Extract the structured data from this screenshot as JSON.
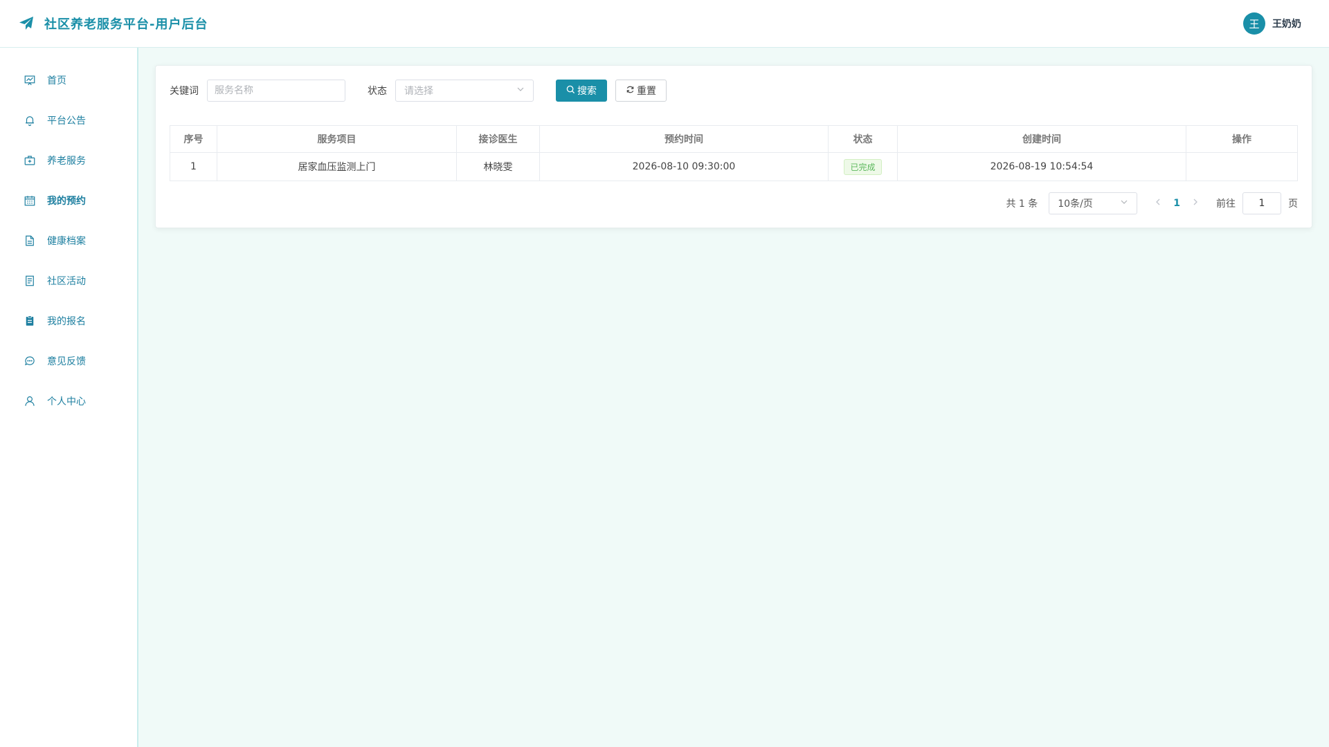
{
  "header": {
    "title": "社区养老服务平台-用户后台",
    "avatar_letter": "王",
    "user_name": "王奶奶",
    "accent": "#1a8fa8"
  },
  "sidebar": {
    "items": [
      {
        "label": "首页",
        "icon": "dashboard-icon",
        "active": false
      },
      {
        "label": "平台公告",
        "icon": "bell-icon",
        "active": false
      },
      {
        "label": "养老服务",
        "icon": "medical-box-icon",
        "active": false
      },
      {
        "label": "我的预约",
        "icon": "calendar-icon",
        "active": true
      },
      {
        "label": "健康档案",
        "icon": "document-icon",
        "active": false
      },
      {
        "label": "社区活动",
        "icon": "list-icon",
        "active": false
      },
      {
        "label": "我的报名",
        "icon": "clipboard-icon",
        "active": false
      },
      {
        "label": "意见反馈",
        "icon": "chat-icon",
        "active": false
      },
      {
        "label": "个人中心",
        "icon": "user-icon",
        "active": false
      }
    ]
  },
  "filters": {
    "keyword_label": "关键词",
    "keyword_placeholder": "服务名称",
    "status_label": "状态",
    "status_placeholder": "请选择",
    "search_label": "搜索",
    "reset_label": "重置"
  },
  "table": {
    "headers": [
      "序号",
      "服务项目",
      "接诊医生",
      "预约时间",
      "状态",
      "创建时间",
      "操作"
    ],
    "rows": [
      {
        "index": "1",
        "service": "居家血压监测上门",
        "doctor": "林晓雯",
        "appointment_time": "2026-08-10 09:30:00",
        "status": "已完成",
        "created_time": "2026-08-19 10:54:54",
        "actions": ""
      }
    ]
  },
  "pagination": {
    "total": "共 1 条",
    "page_size": "10条/页",
    "current_page": "1",
    "goto_label": "前往",
    "goto_value": "1",
    "page_suffix": "页"
  }
}
